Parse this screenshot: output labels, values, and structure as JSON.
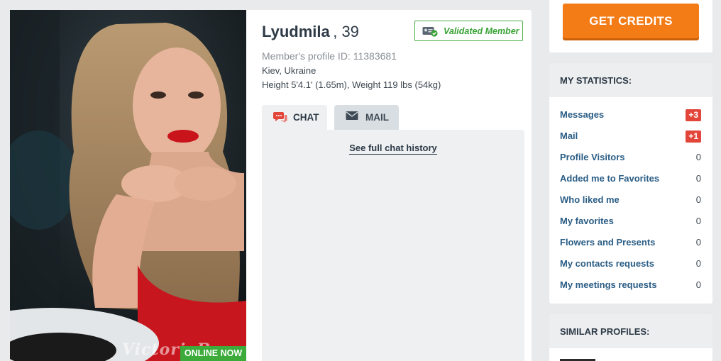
{
  "profile": {
    "name": "Lyudmila",
    "age": ", 39",
    "validated_label": "Validated Member",
    "profile_id": "Member's profile ID: 11383681",
    "location": "Kiev, Ukraine",
    "height_weight": "Height 5'4.1' (1.65m), Weight 119 lbs (54kg)",
    "online_badge": "ONLINE NOW",
    "watermark": "VictoriaBr"
  },
  "tabs": {
    "chat": "CHAT",
    "mail": "MAIL"
  },
  "chat": {
    "history_link": "See full chat history"
  },
  "sidebar": {
    "credits_button": "GET CREDITS",
    "stats_title": "MY STATISTICS:",
    "stats": [
      {
        "label": "Messages",
        "value": "+3",
        "badge": true
      },
      {
        "label": "Mail",
        "value": "+1",
        "badge": true
      },
      {
        "label": "Profile Visitors",
        "value": "0",
        "badge": false
      },
      {
        "label": "Added me to Favorites",
        "value": "0",
        "badge": false
      },
      {
        "label": "Who liked me",
        "value": "0",
        "badge": false
      },
      {
        "label": "My favorites",
        "value": "0",
        "badge": false
      },
      {
        "label": "Flowers and Presents",
        "value": "0",
        "badge": false
      },
      {
        "label": "My contacts requests",
        "value": "0",
        "badge": false
      },
      {
        "label": "My meetings requests",
        "value": "0",
        "badge": false
      }
    ],
    "similar_title": "SIMILAR PROFILES:"
  },
  "colors": {
    "accent_orange": "#f47c16",
    "validated_green": "#3aa336",
    "online_green": "#3cab3a",
    "badge_red": "#e2463a",
    "link_blue": "#2a5d85"
  },
  "icons": {
    "chat": "chat-bubbles-icon",
    "mail": "envelope-icon",
    "validated": "id-card-check-icon"
  }
}
